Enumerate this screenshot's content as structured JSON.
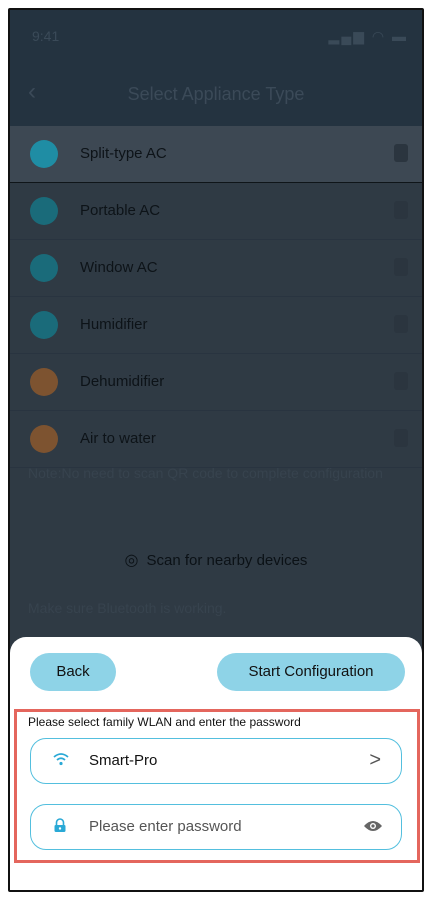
{
  "status_bar": {
    "time": "9:41"
  },
  "nav": {
    "title": "Select Appliance Type"
  },
  "appliances": [
    {
      "label": "Split-type AC",
      "icon": "split-ac-icon",
      "color": "#1f8da4"
    },
    {
      "label": "Portable AC",
      "icon": "portable-ac-icon",
      "color": "#1a6b7a"
    },
    {
      "label": "Window AC",
      "icon": "window-ac-icon",
      "color": "#1a6b7a"
    },
    {
      "label": "Humidifier",
      "icon": "humidifier-icon",
      "color": "#1a6b7a"
    },
    {
      "label": "Dehumidifier",
      "icon": "dehumidifier-icon",
      "color": "#7d5330"
    },
    {
      "label": "Air to water",
      "icon": "air-to-water-icon",
      "color": "#7d5330"
    }
  ],
  "note": "Note:No need to scan QR code to complete configuration",
  "scan": {
    "label": "Scan for nearby devices",
    "icon": "radar-icon"
  },
  "bluetooth_note": "Make sure Bluetooth is working.",
  "sheet": {
    "back_label": "Back",
    "start_label": "Start Configuration",
    "hint": "Please select family WLAN and enter the password",
    "wifi_name": "Smart-Pro",
    "password_placeholder": "Please enter password"
  },
  "colors": {
    "accent": "#53bfde",
    "button": "#8ed3e7",
    "highlight": "#e4665d"
  }
}
